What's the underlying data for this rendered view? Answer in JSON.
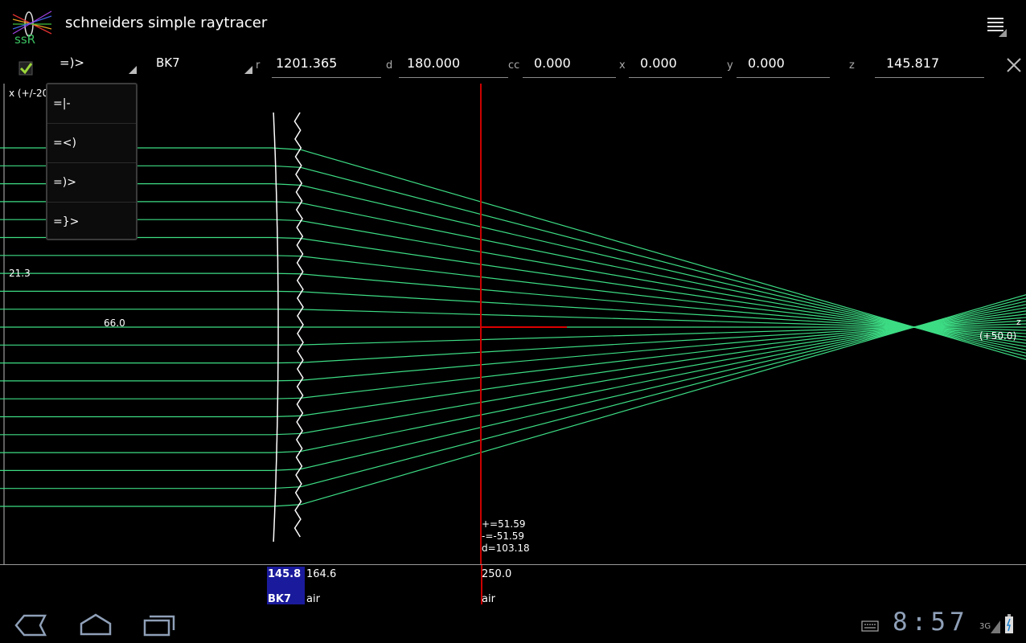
{
  "app": {
    "title": "schneiders simple raytracer",
    "icon_text": "ssR"
  },
  "toolbar": {
    "surface_type": "=)>",
    "material": "BK7",
    "fields": [
      {
        "label": "r",
        "value": "1201.365"
      },
      {
        "label": "d",
        "value": "180.000"
      },
      {
        "label": "cc",
        "value": "0.000"
      },
      {
        "label": "x",
        "value": "0.000"
      },
      {
        "label": "y",
        "value": "0.000"
      },
      {
        "label": "z",
        "value": "145.817"
      }
    ],
    "checkbox_checked": true
  },
  "dropdown": {
    "options": [
      "=|-",
      "=<)",
      "=)>",
      "=}>"
    ]
  },
  "plot": {
    "axis_label": "x (+/-20",
    "label_left": "21.3",
    "label_mid": "66.0",
    "label_right": "(+50.0)",
    "axis_letter": "z",
    "measurements": [
      "+=51.59",
      "-=-51.59",
      "d=103.18"
    ],
    "ray_color": "#3ddc84",
    "marker_color": "#cc0000"
  },
  "strip": {
    "surfaces": [
      {
        "z": "145.8",
        "material": "BK7",
        "selected": true
      },
      {
        "z": "164.6",
        "material": "air",
        "selected": false
      },
      {
        "z": "250.0",
        "material": "air",
        "selected": false
      }
    ],
    "selected_color": "#1a1a9c"
  },
  "status": {
    "clock": "8:57",
    "network": "3G"
  }
}
